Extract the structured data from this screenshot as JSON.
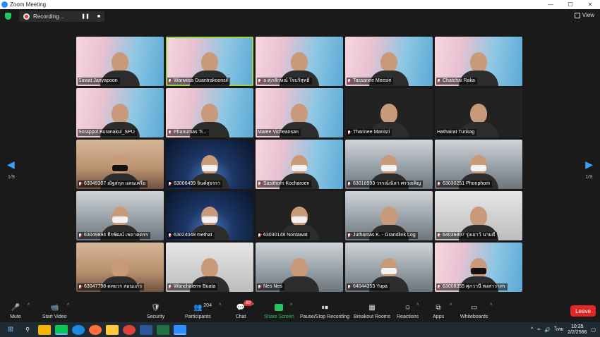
{
  "window": {
    "title": "Zoom Meeting",
    "minimize": "—",
    "maximize": "☐",
    "close": "✕"
  },
  "topbar": {
    "recording_label": "Recording...",
    "pause": "❚❚",
    "stop": "■",
    "view_label": "View"
  },
  "pagination": {
    "left": "1/9",
    "right": "1/9"
  },
  "tiles": [
    {
      "name": "Suwat Janyapoon",
      "bg": "bg-spu",
      "muted": false
    },
    {
      "name": "Wanwisa Duantrakoonsil",
      "bg": "bg-spu",
      "muted": true,
      "active": true
    },
    {
      "name": "อ.ศุภลักษณ์ ใจบริสุทธิ์",
      "bg": "bg-spu",
      "muted": true
    },
    {
      "name": "Tassanee Meesiri",
      "bg": "bg-spu",
      "muted": true
    },
    {
      "name": "Chatchai Raka",
      "bg": "bg-spu",
      "muted": true
    },
    {
      "name": "Sorappol Buranakul_SPU",
      "bg": "bg-spu",
      "muted": false
    },
    {
      "name": "Phanumas Ti...",
      "bg": "bg-spu",
      "muted": true
    },
    {
      "name": "Matee Vicheansan",
      "bg": "bg-spu",
      "muted": false
    },
    {
      "name": "Tharinee Manisri",
      "bg": "bg-dark",
      "muted": true
    },
    {
      "name": "Hathairat Tunkag",
      "bg": "bg-dark",
      "muted": false
    },
    {
      "name": "63049387 ณัฐสกุล แคนเครือ",
      "bg": "bg-warm",
      "muted": true
    },
    {
      "name": "63006499 จินต์สุจรรา",
      "bg": "bg-space",
      "muted": true
    },
    {
      "name": "Sasithorn Kocharoen",
      "bg": "bg-spu",
      "muted": true
    },
    {
      "name": "63018993 วรรณ์ณิลา ศรวงเพ็ญ",
      "bg": "bg-office",
      "muted": true
    },
    {
      "name": "63030251 Phonphom",
      "bg": "bg-office",
      "muted": true
    },
    {
      "name": "63049894 ธีรพัฒน์ เพลาคตรร",
      "bg": "bg-office",
      "muted": true
    },
    {
      "name": "63024048 methat",
      "bg": "bg-space",
      "muted": true
    },
    {
      "name": "63030148 Nontawat",
      "bg": "bg-dark",
      "muted": true
    },
    {
      "name": "Juthamas K. - Grandlink Log",
      "bg": "bg-office",
      "muted": true
    },
    {
      "name": "64036897 รุ่งเยาว์ นามดี",
      "bg": "bg-grey",
      "muted": true
    },
    {
      "name": "63047798 ดทยวร สอนแก้ว",
      "bg": "bg-warm",
      "muted": true
    },
    {
      "name": "Wanchalerm Buata",
      "bg": "bg-grey",
      "muted": true
    },
    {
      "name": "Nes Nes",
      "bg": "bg-office",
      "muted": true
    },
    {
      "name": "64044353 Yupa",
      "bg": "bg-office",
      "muted": true
    },
    {
      "name": "63008355 ศุภวานี พงสาวาสร",
      "bg": "bg-spu",
      "muted": true
    }
  ],
  "toolbar": {
    "mute": "Mute",
    "start_video": "Start Video",
    "security": "Security",
    "participants": "Participants",
    "participants_count": "204",
    "chat": "Chat",
    "chat_badge": "69",
    "share_screen": "Share Screen",
    "pause_recording": "Pause/Stop Recording",
    "breakout_rooms": "Breakout Rooms",
    "reactions": "Reactions",
    "apps": "Apps",
    "whiteboards": "Whiteboards",
    "leave": "Leave"
  },
  "taskbar": {
    "time": "10:35",
    "date": "2/2/2566",
    "lang": "ไทย"
  },
  "colors": {
    "accent": "#2d8cff",
    "share": "#22c55e",
    "leave": "#e02828",
    "active_speaker": "#9bd34a"
  }
}
